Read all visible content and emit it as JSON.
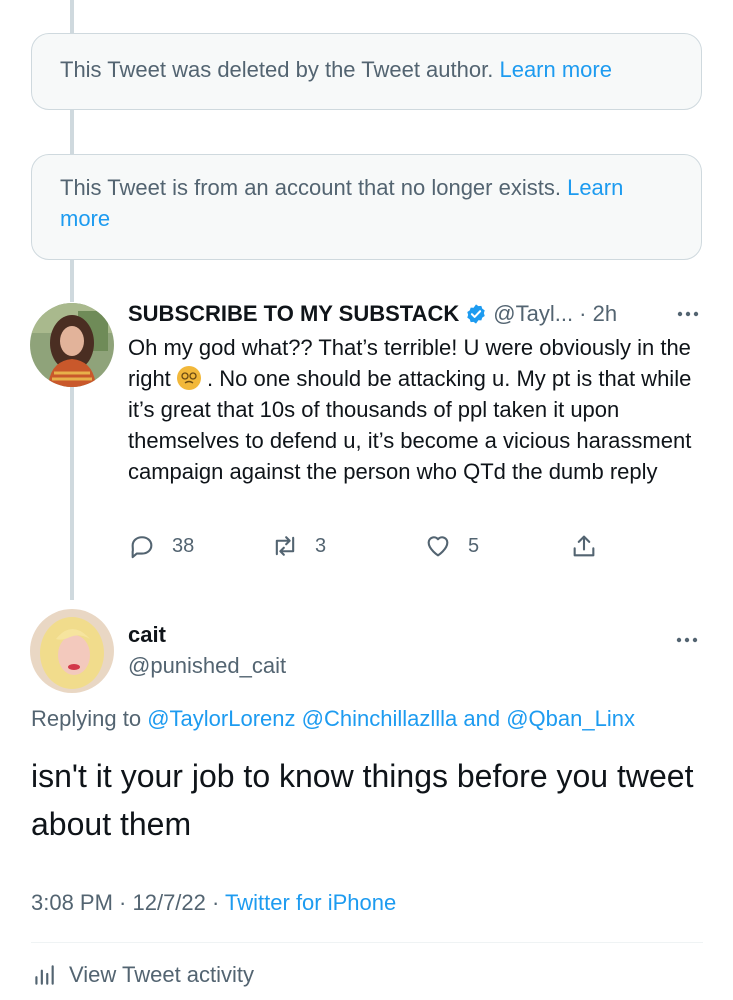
{
  "notices": {
    "deleted": {
      "text": "This Tweet was deleted by the Tweet author.",
      "link": "Learn more"
    },
    "account_gone": {
      "text": "This Tweet is from an account that no longer exists.",
      "link": "Learn more"
    }
  },
  "reply_tweet": {
    "display_name": "SUBSCRIBE TO MY SUBSTACK",
    "handle_time": "@Tayl... · 2h",
    "text_before_emoji": "Oh my god what?? That’s terrible! U were obviously in the right",
    "text_after_emoji": ". No one should be attacking u. My pt is that while it’s great that 10s of thousands of ppl taken it upon themselves to defend u, it’s become a vicious harassment campaign against the person who QTd the dumb reply",
    "reply_count": "38",
    "retweet_count": "3",
    "like_count": "5"
  },
  "main_tweet": {
    "display_name": "cait",
    "handle": "@punished_cait",
    "replying_prefix": "Replying to",
    "replying_users": [
      "@TaylorLorenz",
      "@Chinchillazllla"
    ],
    "replying_and": "and",
    "replying_last": "@Qban_Linx",
    "text": "isn't it your job to know things before you tweet about them",
    "time": "3:08 PM · 12/7/22 · ",
    "source": "Twitter for iPhone",
    "activity_label": "View Tweet activity"
  },
  "colors": {
    "accent": "#1d9bf0",
    "secondary_text": "#536471",
    "notice_bg": "#f7f9f9"
  },
  "icons": [
    "verified-badge-icon",
    "more-icon",
    "reply-icon",
    "retweet-icon",
    "like-icon",
    "share-icon",
    "analytics-icon"
  ]
}
